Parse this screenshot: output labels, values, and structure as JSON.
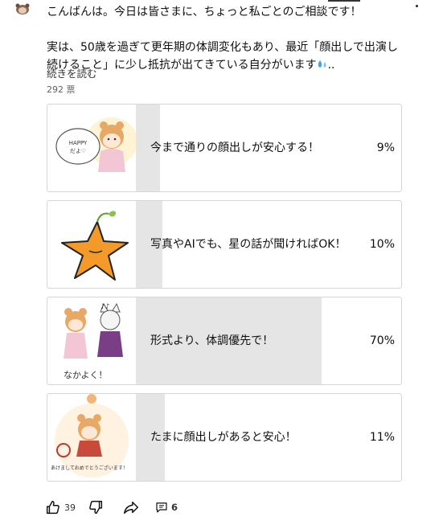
{
  "post": {
    "line1": "こんばんは。今日は皆さまに、ちょっと私ごとのご相談です！",
    "line2": "実は、50歳を過ぎて更年期の体調変化もあり、最近「顔出しで出演し",
    "line3": "続けること」に少し抵抗が出てきている自分がいます",
    "line3_tail": "..",
    "read_more": "続きを読む",
    "votes": "292 票"
  },
  "poll": {
    "options": [
      {
        "label": "今まで通りの顔出しが安心する！",
        "percent_label": "9%",
        "percent": 9,
        "image_text": "HAPPY だよ♡"
      },
      {
        "label": "写真やAIでも、星の話が聞ければOK！",
        "percent_label": "10%",
        "percent": 10
      },
      {
        "label": "形式より、体調優先で！",
        "percent_label": "70%",
        "percent": 70,
        "image_text": "なかよく！"
      },
      {
        "label": "たまに顔出しがあると安心！",
        "percent_label": "11%",
        "percent": 11,
        "image_text": "あけましておめでとうございます！"
      }
    ]
  },
  "actions": {
    "likes": "39",
    "comments": "6"
  },
  "colors": {
    "bar": "#e5e5e5",
    "border": "#d6d6d6",
    "star": "#f39a2b",
    "bear": "#e8a866"
  }
}
